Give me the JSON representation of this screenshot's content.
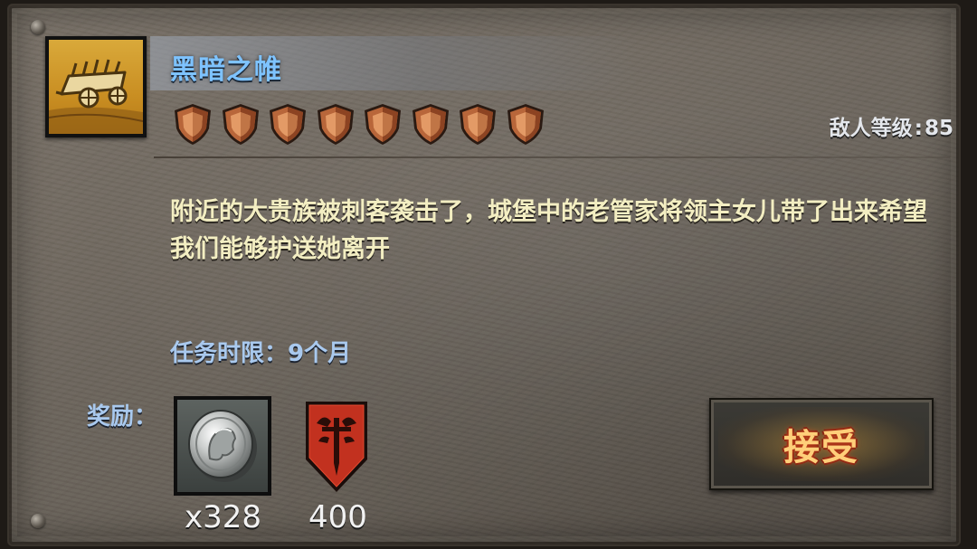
{
  "mission": {
    "title": "黑暗之帷",
    "difficulty_stars": 8,
    "enemy_level_label": "敌人等级",
    "enemy_level_separator": ":",
    "enemy_level_value": "85",
    "description": "附近的大贵族被刺客袭击了，城堡中的老管家将领主女儿带了出来希望我们能够护送她离开",
    "deadline": "任务时限：9个月",
    "icon": "caravan-wagon-icon"
  },
  "rewards": {
    "label": "奖励：",
    "items": [
      {
        "icon": "silver-coin-icon",
        "count": "x328"
      },
      {
        "icon": "red-shield-sword-emblem-icon",
        "count": "400"
      }
    ]
  },
  "actions": {
    "accept_label": "接受"
  },
  "colors": {
    "title": "#7ec3ff",
    "description": "#f3eec2",
    "deadline": "#a9c9ee",
    "accept_text": "#ffcf7a",
    "star_copper": "#b8663a"
  }
}
